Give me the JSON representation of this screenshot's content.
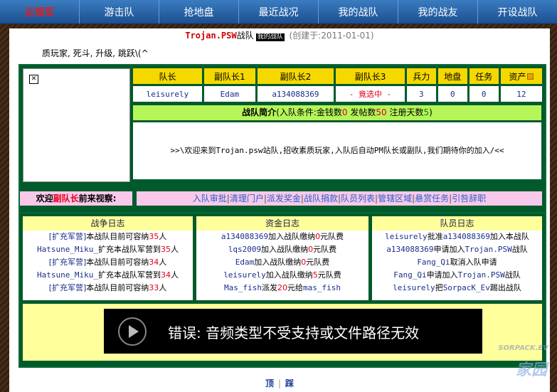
{
  "nav": {
    "brand": "正规军",
    "items": [
      "游击队",
      "抢地盘",
      "最近战况",
      "我的战队",
      "我的战友",
      "开设战队"
    ]
  },
  "header": {
    "team_name": "Trojan.PSW",
    "team_suffix": "战队",
    "badge": "我的战队",
    "created": "(创建于:2011-01-01)",
    "motto": "质玩家, 死斗, 升级, 跳跃\\(^"
  },
  "stats": {
    "headers": [
      "队长",
      "副队长1",
      "副队长2",
      "副队长3",
      "兵力",
      "地盘",
      "任务",
      "资产"
    ],
    "values": [
      "leisurely",
      "Edam",
      "a134088369",
      "- 竟选中 -",
      "3",
      "0",
      "0",
      "12"
    ]
  },
  "intro": {
    "title": "战队简介",
    "condition_prefix": "(入队条件:金钱数",
    "money": "0",
    "posts_label": " 发帖数",
    "posts": "50",
    "days_label": " 注册天数",
    "days": "5",
    "close": ")",
    "text": ">>\\欢迎来到Trojan.psw站队,招收素质玩家,入队后自动PM队长或副队,我们期待你的加入/<<"
  },
  "welcome": {
    "prefix": "欢迎",
    "role": "副队长",
    "suffix": "前来视察:"
  },
  "admin_links": [
    "入队审批",
    "清理门户",
    "派发奖金",
    "战队捐款",
    "队员列表",
    "管辖区域",
    "悬赏任务",
    "引咎辞职"
  ],
  "logs": {
    "war": {
      "title": "战争日志",
      "lines": [
        {
          "tag": "[扩充军营]",
          "text": "本战队目前可容纳",
          "num": "35",
          "unit": "人"
        },
        {
          "tag": "Hatsune_Miku_",
          "text": "扩充本战队军营到",
          "num": "35",
          "unit": "人"
        },
        {
          "tag": "[扩充军营]",
          "text": "本战队目前可容纳",
          "num": "34",
          "unit": "人"
        },
        {
          "tag": "Hatsune_Miku_",
          "text": "扩充本战队军营到",
          "num": "34",
          "unit": "人"
        },
        {
          "tag": "[扩充军营]",
          "text": "本战队目前可容纳",
          "num": "33",
          "unit": "人"
        }
      ]
    },
    "funds": {
      "title": "资金日志",
      "lines": [
        {
          "name": "a134088369",
          "text": "加入战队缴纳",
          "num": "0",
          "unit": "元队费"
        },
        {
          "name": "lqs2009",
          "text": "加入战队缴纳",
          "num": "0",
          "unit": "元队费"
        },
        {
          "name": "Edam",
          "text": "加入战队缴纳",
          "num": "0",
          "unit": "元队费"
        },
        {
          "name": "leisurely",
          "text": "加入战队缴纳",
          "num": "5",
          "unit": "元队费"
        },
        {
          "name": "Mas_fish",
          "text": "派发",
          "num": "20",
          "unit": "元给",
          "target": "mas_fish"
        }
      ]
    },
    "members": {
      "title": "队员日志",
      "lines": [
        {
          "a": "leisurely",
          "text": "批准",
          "b": "a134088369",
          "tail": "加入本战队"
        },
        {
          "a": "a134088369",
          "text": "申请加入",
          "b": "Trojan.PSW",
          "tail": "战队"
        },
        {
          "a": "Fang_Qi",
          "text": "取消入队申请",
          "b": "",
          "tail": ""
        },
        {
          "a": "Fang_Qi",
          "text": "申请加入",
          "b": "Trojan.PSW",
          "tail": "战队"
        },
        {
          "a": "leisurely",
          "text": "把",
          "b": "SorpacK_Ev",
          "tail": "踢出战队"
        }
      ]
    }
  },
  "video_error": "错误: 音频类型不受支持或文件路径无效",
  "footer": {
    "top": "顶",
    "bottom": "踩"
  },
  "watermark": {
    "text": "SORPACK.EV",
    "logo": "家园"
  }
}
